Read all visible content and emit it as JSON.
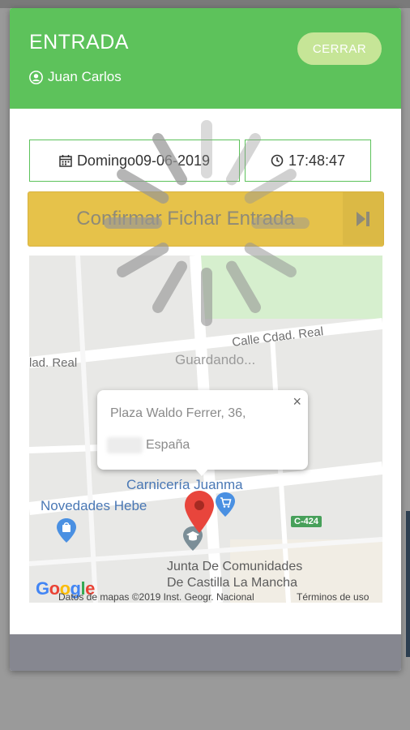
{
  "header": {
    "title": "ENTRADA",
    "user_name": "Juan Carlos",
    "close_label": "CERRAR",
    "color": "#5dc25b"
  },
  "fields": {
    "date": "Domingo09-06-2019",
    "time": "17:48:47"
  },
  "confirm": {
    "label": "Confirmar Fichar Entrada",
    "color": "#e6c24a"
  },
  "map": {
    "streets": [
      "Calle Cdad. Real",
      "lad. Real"
    ],
    "saving_text": "Guardando...",
    "places": [
      "Carnicería Juanma",
      "Novedades Hebe"
    ],
    "poi": [
      "Junta De Comunidades",
      "De Castilla La Mancha"
    ],
    "road_badge": "C-424",
    "popup": {
      "line1": "Plaza Waldo Ferrer, 36,",
      "line2": "España"
    },
    "google": "Google",
    "attribution": "Datos de mapas ©2019 Inst. Geogr. Nacional",
    "terms": "Términos de uso"
  },
  "icons": [
    "user-circle-icon",
    "calendar-icon",
    "clock-icon",
    "step-forward-icon",
    "close-icon",
    "map-pin-icon",
    "shopping-cart-icon",
    "shopping-bag-icon",
    "school-icon",
    "loading-spinner-icon"
  ]
}
